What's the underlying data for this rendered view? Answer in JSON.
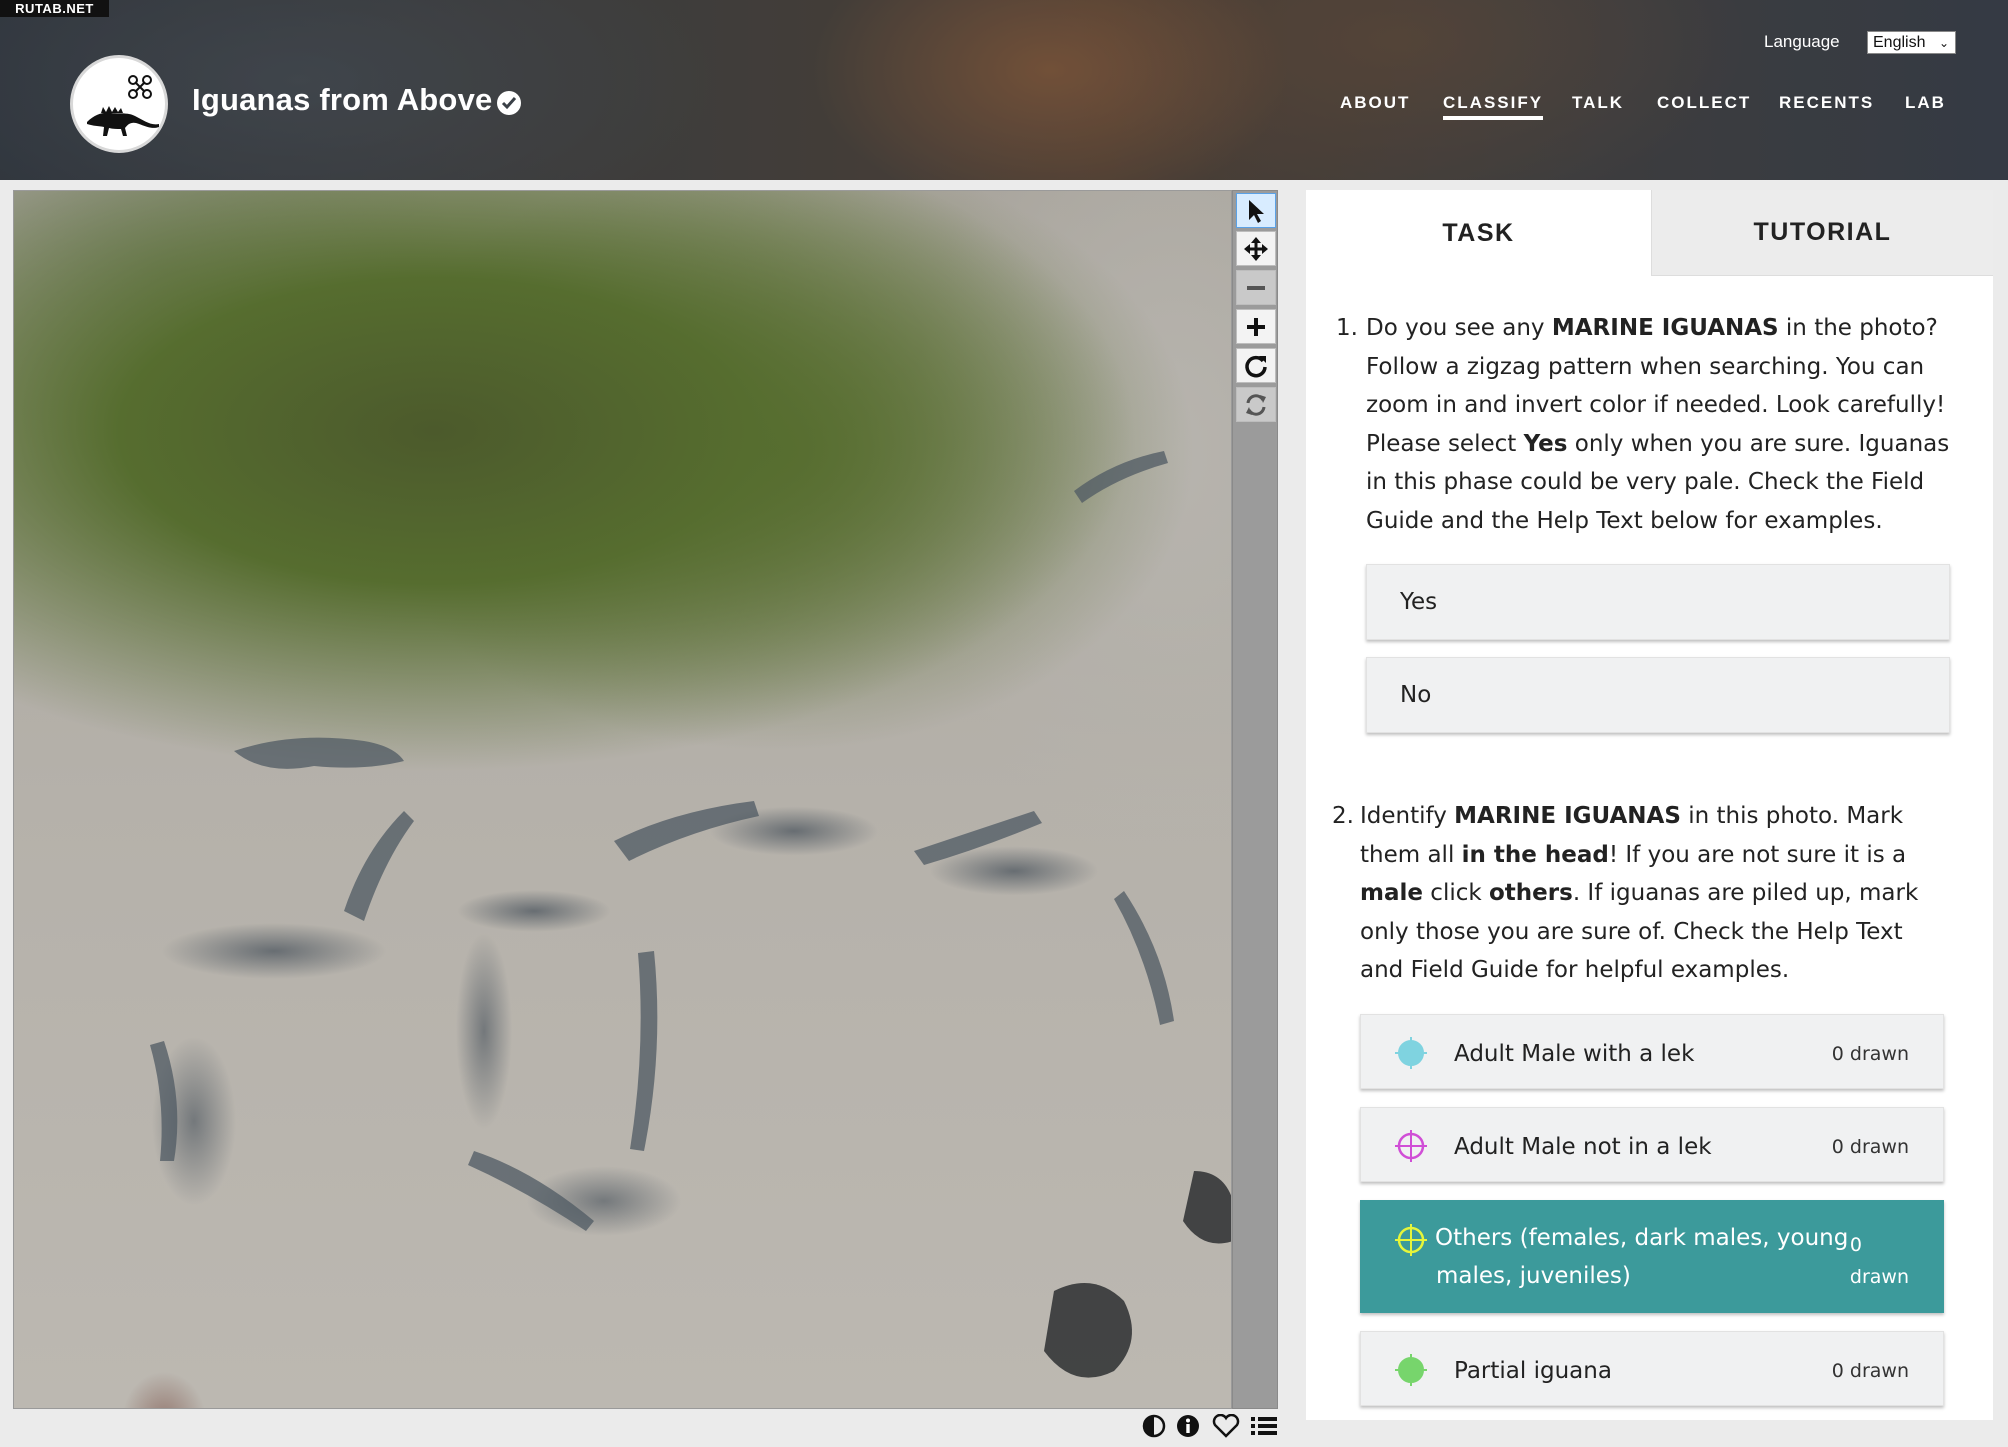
{
  "site_badge": "RUTAB.NET",
  "header": {
    "project_title": "Iguanas from Above",
    "language_label": "Language",
    "language_selected": "English",
    "nav": [
      {
        "label": "ABOUT",
        "active": false
      },
      {
        "label": "CLASSIFY",
        "active": true
      },
      {
        "label": "TALK",
        "active": false
      },
      {
        "label": "COLLECT",
        "active": false
      },
      {
        "label": "RECENTS",
        "active": false
      },
      {
        "label": "LAB",
        "active": false
      }
    ]
  },
  "toolbar": {
    "tools": [
      {
        "name": "pointer-icon",
        "state": "active"
      },
      {
        "name": "move-icon",
        "state": "normal"
      },
      {
        "name": "zoom-out-icon",
        "state": "disabled"
      },
      {
        "name": "zoom-in-icon",
        "state": "normal"
      },
      {
        "name": "rotate-icon",
        "state": "normal"
      },
      {
        "name": "reset-icon",
        "state": "disabled"
      }
    ]
  },
  "viewer_footer": {
    "icons": [
      "invert-icon",
      "info-icon",
      "heart-icon",
      "list-icon"
    ]
  },
  "panel": {
    "tabs": {
      "task": "TASK",
      "tutorial": "TUTORIAL"
    },
    "q1": {
      "number": "1.",
      "lines": [
        [
          "Do you see any ",
          "MARINE IGUANAS",
          " in the photo?"
        ],
        [
          "Follow a zigzag pattern when searching. You can"
        ],
        [
          "zoom in and invert color if needed. Look carefully!"
        ],
        [
          "Please select ",
          "Yes",
          " only when you are sure. Iguanas"
        ],
        [
          "in this phase could be very pale. Check the Field"
        ],
        [
          "Guide and the Help Text below for examples."
        ]
      ],
      "answers": [
        "Yes",
        "No"
      ]
    },
    "q2": {
      "number": "2.",
      "lines": [
        [
          "Identify ",
          "MARINE IGUANAS",
          " in this photo. Mark"
        ],
        [
          "them all ",
          "in the head",
          "! If you are not sure it is a"
        ],
        [
          "",
          "male",
          " click ",
          "others",
          ". If iguanas are piled up, mark"
        ],
        [
          "only those you are sure of. Check the Help Text"
        ],
        [
          "and Field Guide for helpful examples."
        ]
      ],
      "tools": [
        {
          "label": "Adult Male with a lek",
          "count": "0 drawn",
          "color": "#7fd3e0"
        },
        {
          "label": "Adult Male not in a lek",
          "count": "0 drawn",
          "color": "#d04ed6"
        },
        {
          "label_line1": "Others (females, dark males, young",
          "label_line2": "males, juveniles)",
          "count_line1": "0",
          "count_line2": "drawn",
          "color": "#e6f53a"
        },
        {
          "label": "Partial iguana",
          "count": "0 drawn",
          "color": "#77d56c"
        }
      ]
    }
  }
}
